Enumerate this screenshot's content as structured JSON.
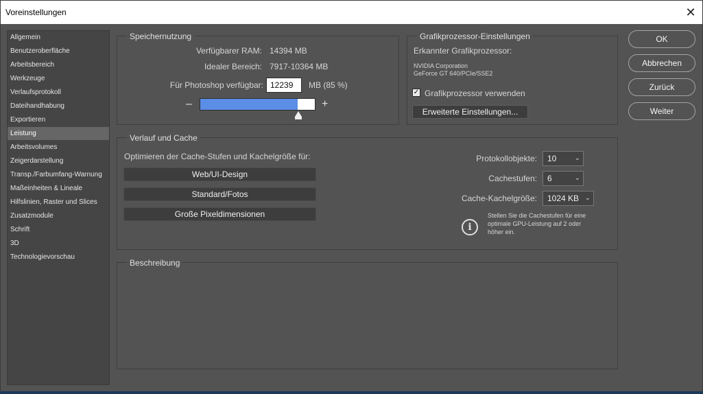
{
  "window": {
    "title": "Voreinstellungen",
    "close_glyph": "✕"
  },
  "sidebar": {
    "items": [
      {
        "label": "Allgemein",
        "selected": false
      },
      {
        "label": "Benutzeroberfläche",
        "selected": false
      },
      {
        "label": "Arbeitsbereich",
        "selected": false
      },
      {
        "label": "Werkzeuge",
        "selected": false
      },
      {
        "label": "Verlaufsprotokoll",
        "selected": false
      },
      {
        "label": "Dateihandhabung",
        "selected": false
      },
      {
        "label": "Exportieren",
        "selected": false
      },
      {
        "label": "Leistung",
        "selected": true
      },
      {
        "label": "Arbeitsvolumes",
        "selected": false
      },
      {
        "label": "Zeigerdarstellung",
        "selected": false
      },
      {
        "label": "Transp./Farbumfang-Warnung",
        "selected": false
      },
      {
        "label": "Maßeinheiten & Lineale",
        "selected": false
      },
      {
        "label": "Hilfslinien, Raster und Slices",
        "selected": false
      },
      {
        "label": "Zusatzmodule",
        "selected": false
      },
      {
        "label": "Schrift",
        "selected": false
      },
      {
        "label": "3D",
        "selected": false
      },
      {
        "label": "Technologievorschau",
        "selected": false
      }
    ]
  },
  "memory": {
    "title": "Speichernutzung",
    "available_ram_label": "Verfügbarer RAM:",
    "available_ram_value": "14394 MB",
    "ideal_range_label": "Idealer Bereich:",
    "ideal_range_value": "7917-10364 MB",
    "photoshop_label": "Für Photoshop verfügbar:",
    "photoshop_value": "12239",
    "photoshop_unit": "MB (85 %)",
    "slider_fraction": 0.85,
    "minus": "–",
    "plus": "+"
  },
  "gpu": {
    "title": "Grafikprozessor-Einstellungen",
    "detected_label": "Erkannter Grafikprozessor:",
    "vendor": "NVIDIA Corporation",
    "model": "GeForce GT 640/PCIe/SSE2",
    "use_gpu_label": "Grafikprozessor verwenden",
    "use_gpu_checked": true,
    "check_glyph": "✓",
    "advanced_button": "Erweiterte Einstellungen..."
  },
  "history_cache": {
    "title": "Verlauf und Cache",
    "optimize_label": "Optimieren der Cache-Stufen und Kachelgröße für:",
    "buttons": [
      "Web/UI-Design",
      "Standard/Fotos",
      "Große Pixeldimensionen"
    ],
    "history_states_label": "Protokollobjekte:",
    "history_states_value": "10",
    "cache_levels_label": "Cachestufen:",
    "cache_levels_value": "6",
    "tile_size_label": "Cache-Kachelgröße:",
    "tile_size_value": "1024 KB",
    "info_glyph": "i",
    "info_text_line1": "Stellen Sie die Cachestufen für eine",
    "info_text_line2": "optimale GPU-Leistung auf 2 oder",
    "info_text_line3": "höher ein."
  },
  "description": {
    "title": "Beschreibung"
  },
  "actions": {
    "ok": "OK",
    "cancel": "Abbrechen",
    "back": "Zurück",
    "next": "Weiter"
  },
  "colors": {
    "slider_fill": "#5b8ee6",
    "selected_item": "#666666",
    "panel_bg": "#535353"
  }
}
